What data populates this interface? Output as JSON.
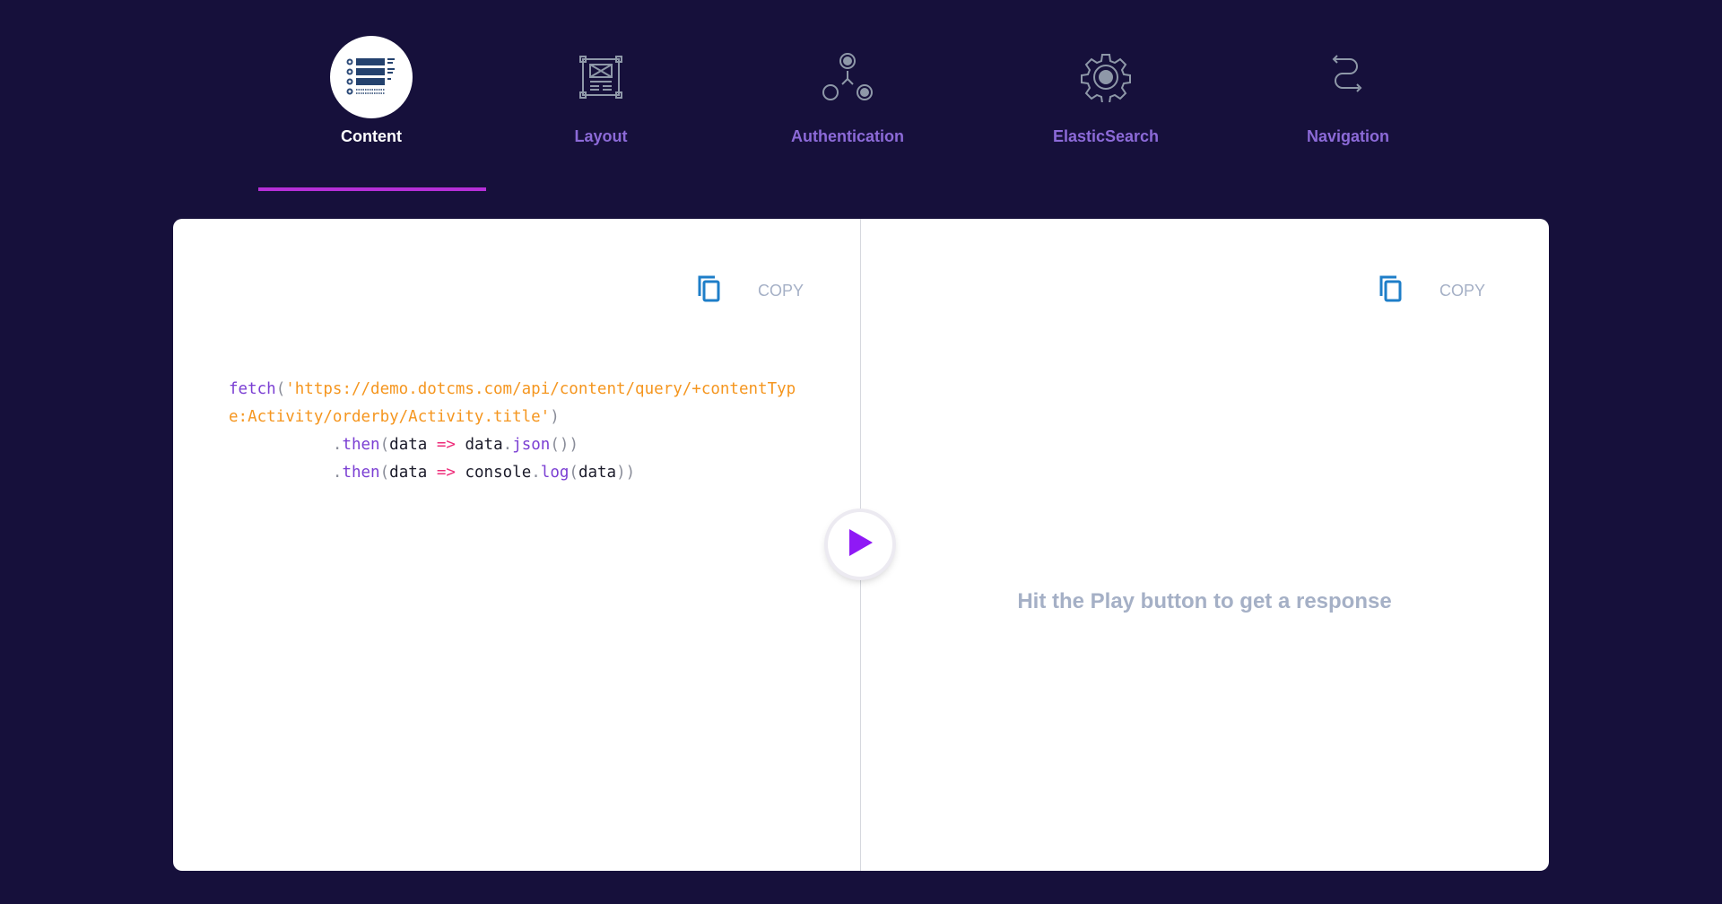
{
  "tabs": [
    {
      "label": "Content",
      "icon": "content-list-icon",
      "active": true
    },
    {
      "label": "Layout",
      "icon": "layout-icon"
    },
    {
      "label": "Authentication",
      "icon": "authentication-icon"
    },
    {
      "label": "ElasticSearch",
      "icon": "gear-icon"
    },
    {
      "label": "Navigation",
      "icon": "navigation-icon"
    }
  ],
  "request": {
    "copy_label": "COPY",
    "code": {
      "fn": "fetch",
      "open": "(",
      "url_1": "'https://demo.dotcms.com/api/content/query/+contentTyp",
      "url_2": "e:Activity/orderby/Activity.title'",
      "close": ")",
      "indent": "           ",
      "dot": ".",
      "then": "then",
      "arg": "data",
      "arrow": "=>",
      "json": "json",
      "console": "console",
      "log": "log"
    }
  },
  "response": {
    "copy_label": "COPY",
    "message": "Hit the Play button to get a response"
  },
  "colors": {
    "background": "#16103b",
    "accent": "#b62fd8",
    "play": "#8f19f5",
    "copy_icon": "#1e7ec8"
  }
}
